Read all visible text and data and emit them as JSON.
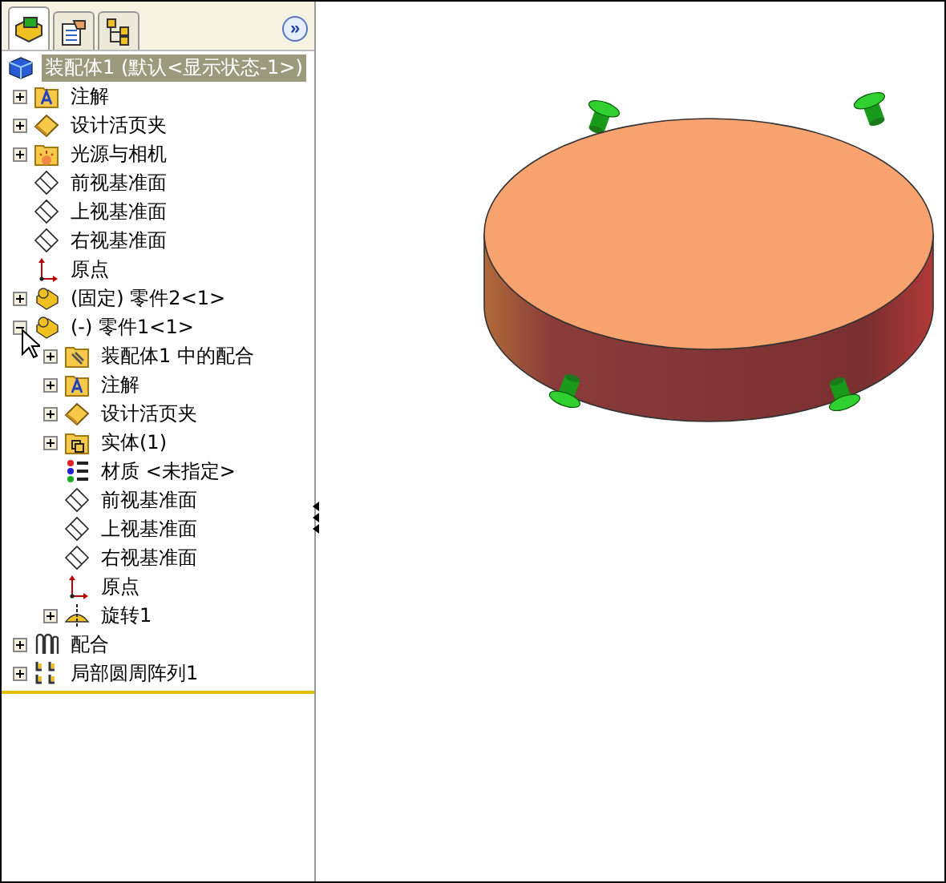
{
  "panel_tabs": [
    {
      "kind": "feature-tree",
      "selected": true
    },
    {
      "kind": "properties",
      "selected": false
    },
    {
      "kind": "configurations",
      "selected": false
    }
  ],
  "expand_button": {
    "label": "»"
  },
  "tree": {
    "root": {
      "label": "装配体1  (默认<显示状态-1>)",
      "kind": "assembly",
      "selected": true,
      "children": [
        {
          "label": "注解",
          "kind": "annotation",
          "expanded": false
        },
        {
          "label": "设计活页夹",
          "kind": "binder",
          "expanded": false
        },
        {
          "label": "光源与相机",
          "kind": "lights",
          "expanded": false
        },
        {
          "label": "前视基准面",
          "kind": "plane"
        },
        {
          "label": "上视基准面",
          "kind": "plane"
        },
        {
          "label": "右视基准面",
          "kind": "plane"
        },
        {
          "label": "原点",
          "kind": "origin"
        },
        {
          "label": "(固定) 零件2<1>",
          "kind": "part",
          "expanded": false
        },
        {
          "label": "(-) 零件1<1>",
          "kind": "part",
          "expanded": true,
          "children": [
            {
              "label": "装配体1 中的配合",
              "kind": "mates-folder",
              "expanded": false
            },
            {
              "label": "注解",
              "kind": "annotation",
              "expanded": false
            },
            {
              "label": "设计活页夹",
              "kind": "binder",
              "expanded": false
            },
            {
              "label": "实体(1)",
              "kind": "solid-folder",
              "expanded": false
            },
            {
              "label": "材质 <未指定>",
              "kind": "material"
            },
            {
              "label": "前视基准面",
              "kind": "plane"
            },
            {
              "label": "上视基准面",
              "kind": "plane"
            },
            {
              "label": "右视基准面",
              "kind": "plane"
            },
            {
              "label": "原点",
              "kind": "origin"
            },
            {
              "label": "旋转1",
              "kind": "revolve",
              "expanded": false
            }
          ]
        },
        {
          "label": "配合",
          "kind": "mates",
          "expanded": false
        },
        {
          "label": "局部圆周阵列1",
          "kind": "pattern",
          "expanded": false
        }
      ]
    }
  }
}
